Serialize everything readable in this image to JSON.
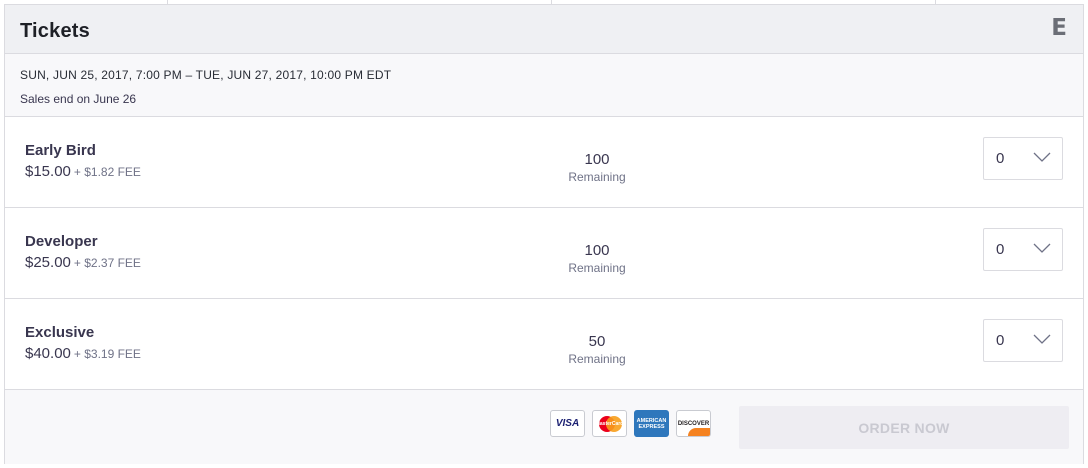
{
  "header": {
    "title": "Tickets",
    "logo": "E"
  },
  "event": {
    "dates": "SUN, JUN 25, 2017, 7:00 PM – TUE, JUN 27, 2017, 10:00 PM EDT",
    "sales_end": "Sales end on June 26"
  },
  "tickets": [
    {
      "name": "Early Bird",
      "price": "$15.00",
      "fee": "+ $1.82 FEE",
      "remaining": "100",
      "remaining_label": "Remaining",
      "quantity": "0"
    },
    {
      "name": "Developer",
      "price": "$25.00",
      "fee": "+ $2.37 FEE",
      "remaining": "100",
      "remaining_label": "Remaining",
      "quantity": "0"
    },
    {
      "name": "Exclusive",
      "price": "$40.00",
      "fee": "+ $3.19 FEE",
      "remaining": "50",
      "remaining_label": "Remaining",
      "quantity": "0"
    }
  ],
  "payment_cards": [
    {
      "name": "visa-icon",
      "label": "VISA"
    },
    {
      "name": "mastercard-icon",
      "label": "MasterCard"
    },
    {
      "name": "amex-icon",
      "label": "AMERICAN EXPRESS"
    },
    {
      "name": "discover-icon",
      "label": "DISCOVER"
    }
  ],
  "footer": {
    "order_label": "ORDER NOW"
  },
  "colors": {
    "header_bg": "#eff0f3",
    "order_disabled_bg": "#eeedf2",
    "order_disabled_text": "#c9c9d1",
    "amex_blue": "#2e77bc",
    "discover_orange": "#f58220"
  }
}
